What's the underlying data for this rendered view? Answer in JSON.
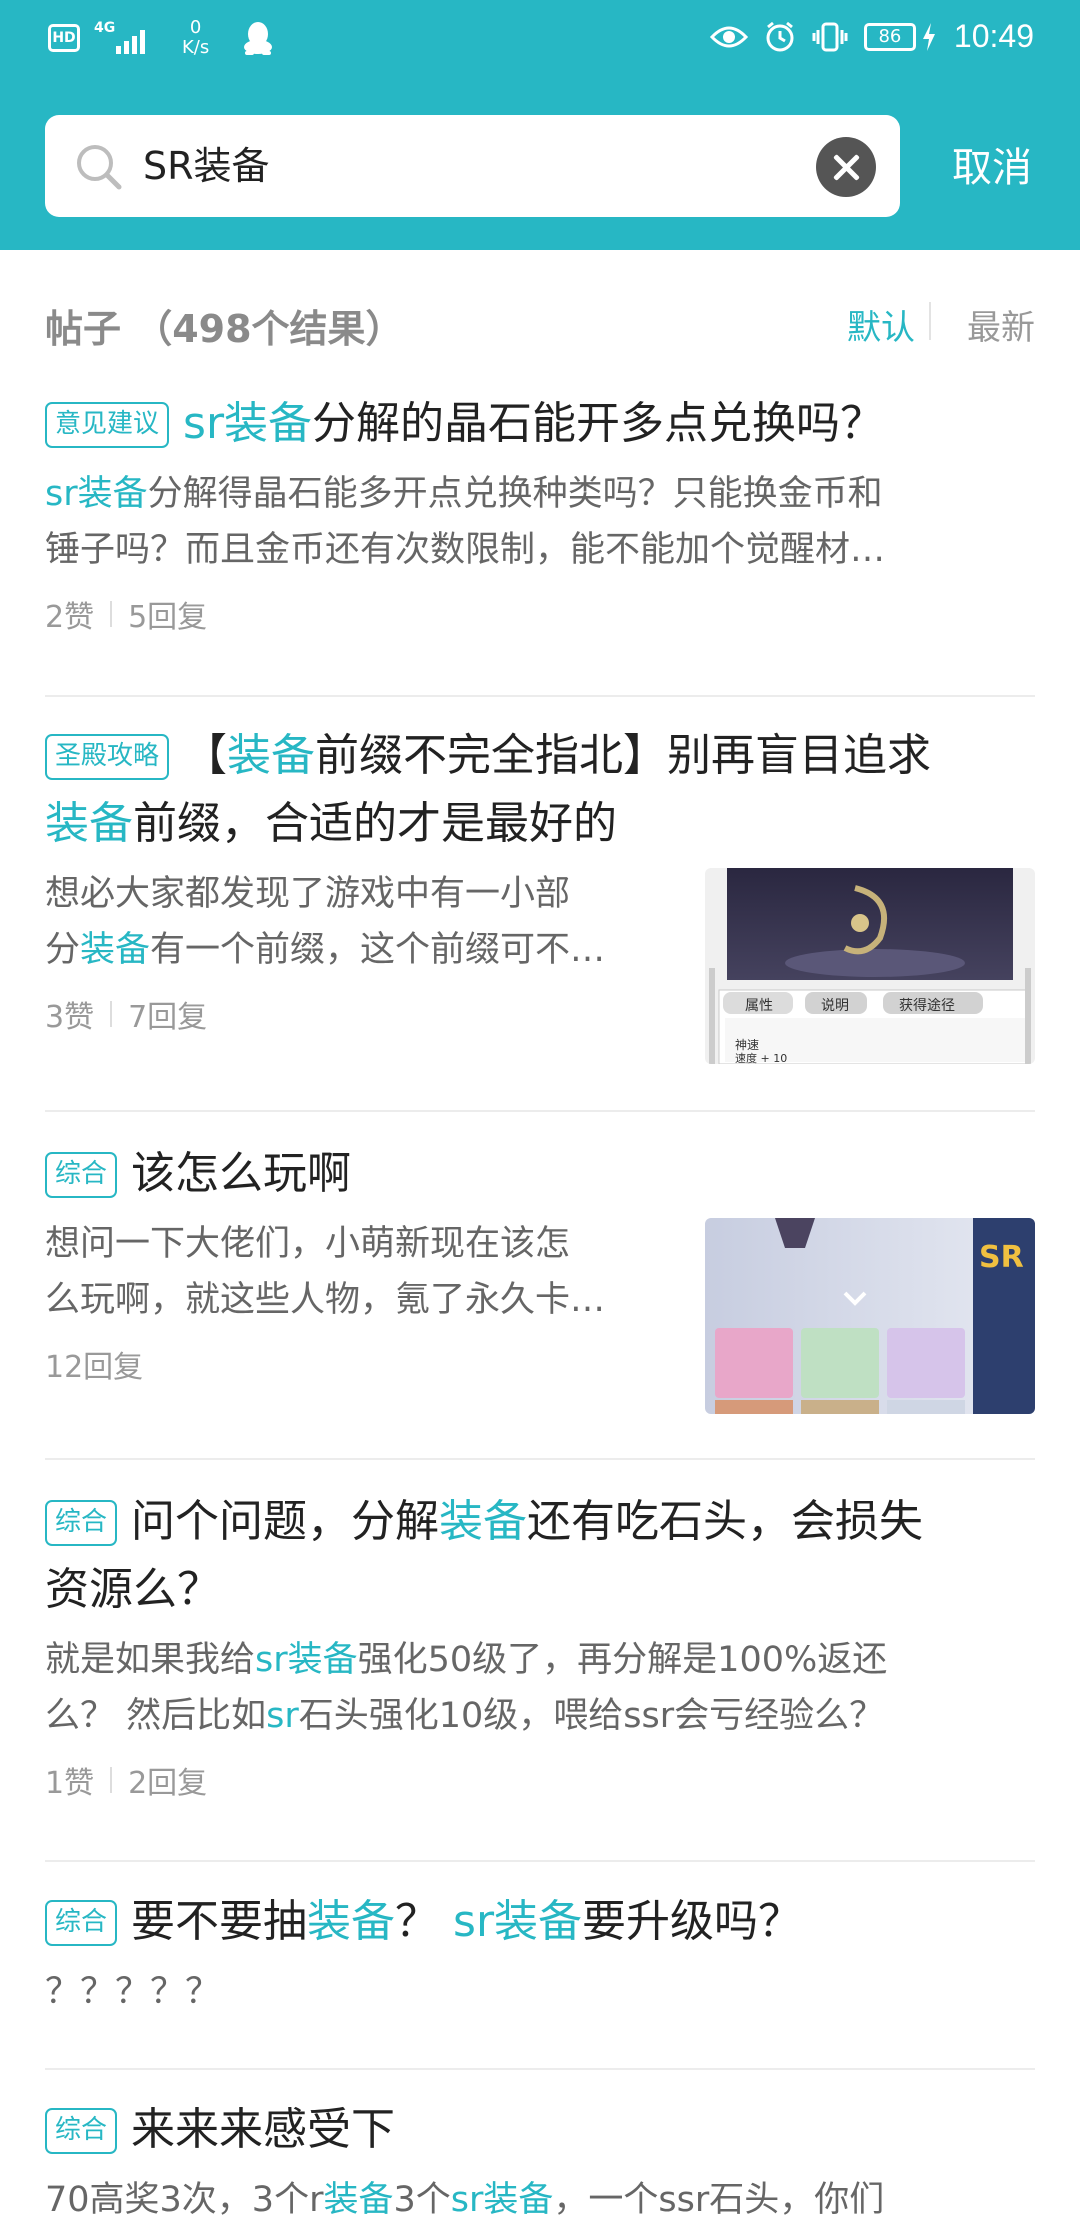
{
  "status_bar": {
    "hd": "HD",
    "network": "4G",
    "speed_value": "0",
    "speed_unit": "K/s",
    "battery": "86",
    "time": "10:49"
  },
  "search": {
    "query": "SR装备",
    "cancel_label": "取消"
  },
  "results": {
    "title": "帖子 （498个结果）",
    "sort_default": "默认",
    "sort_newest": "最新"
  },
  "posts": [
    {
      "tag": "意见建议",
      "title_parts": [
        "sr装备",
        "分解的晶石能开多点兑换吗？"
      ],
      "body_parts": [
        "sr装备",
        "分解得晶石能多开点兑换种类吗？只能换金币和"
      ],
      "body_line2": "锤子吗？而且金币还有次数限制，能不能加个觉醒材…",
      "likes": "2赞",
      "replies": "5回复"
    },
    {
      "tag": "圣殿攻略",
      "title_parts": [
        "【",
        "装备",
        "前缀不完全指北】别再盲目追求"
      ],
      "title_line2_parts": [
        "装备",
        "前缀，合适的才是最好的"
      ],
      "body_line1": "想必大家都发现了游戏中有一小部",
      "body_parts": [
        "分",
        "装备",
        "有一个前缀，这个前缀可不…"
      ],
      "likes": "3赞",
      "replies": "7回复",
      "thumb_tabs": [
        "属性",
        "说明",
        "获得途径"
      ],
      "thumb_text": [
        "神速",
        "速度 + 10"
      ]
    },
    {
      "tag": "综合",
      "title": "该怎么玩啊",
      "body_line1": "想问一下大佬们，小萌新现在该怎",
      "body_line2": "么玩啊，就这些人物，氪了永久卡…",
      "replies": "12回复",
      "thumb_badge": "SR"
    },
    {
      "tag": "综合",
      "title_parts": [
        "问个问题，分解",
        "装备",
        "还有吃石头，会损失"
      ],
      "title_line2": "资源么？",
      "body_parts": [
        "就是如果我给",
        "sr装备",
        "强化50级了，再分解是100%返还"
      ],
      "body_line2_parts": [
        "么？ 然后比如",
        "sr",
        "石头强化10级，喂给ssr会亏经验么？"
      ],
      "likes": "1赞",
      "replies": "2回复"
    },
    {
      "tag": "综合",
      "title_parts": [
        "要不要抽",
        "装备",
        "？ ",
        "sr装备",
        "要升级吗？"
      ],
      "body": "？？？？？"
    },
    {
      "tag": "综合",
      "title": "来来来感受下",
      "body_parts": [
        "70高奖3次，3个r",
        "装备",
        "3个",
        "sr装备",
        "，一个ssr石头，你们"
      ]
    }
  ],
  "colors": {
    "accent": "#27b7c4",
    "header_bg": "#27b7c4"
  }
}
